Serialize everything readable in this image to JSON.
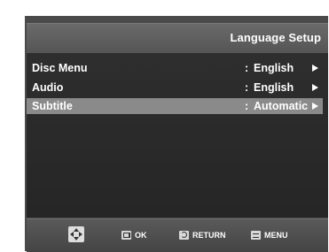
{
  "header": {
    "title": "Language Setup"
  },
  "menu": {
    "separator": ":",
    "items": [
      {
        "label": "Disc Menu",
        "value": "English",
        "selected": false
      },
      {
        "label": "Audio",
        "value": "English",
        "selected": false
      },
      {
        "label": "Subtitle",
        "value": "Automatic",
        "selected": true
      }
    ]
  },
  "footer": {
    "nav_icon": "directional-pad-icon",
    "ok_label": "OK",
    "return_label": "RETURN",
    "menu_label": "MENU"
  },
  "colors": {
    "selected_row": "#8a8a8a",
    "background": "#2a2a2a",
    "header": "#5e5e5e"
  }
}
